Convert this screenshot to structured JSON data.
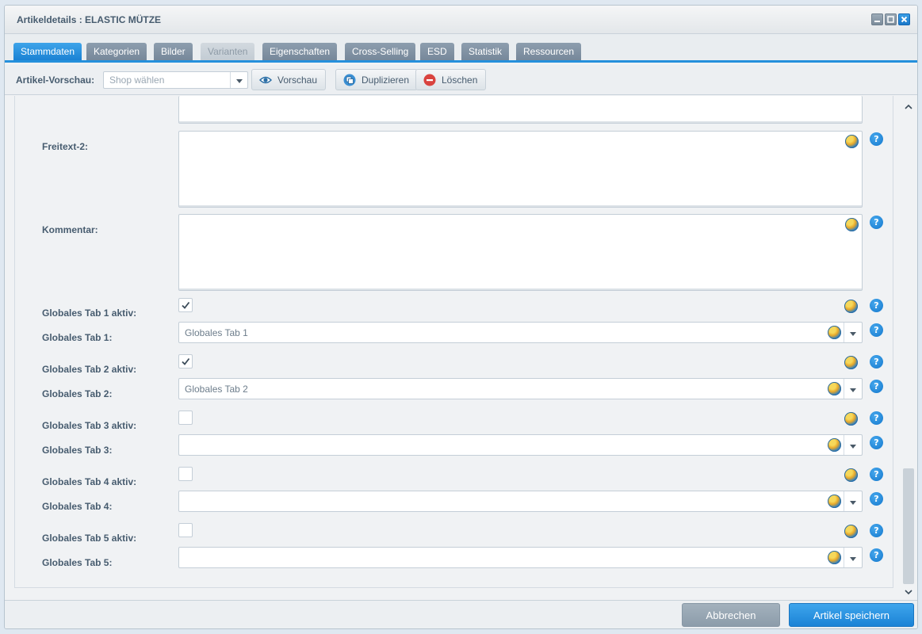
{
  "window": {
    "title": "Artikeldetails : ELASTIC MÜTZE"
  },
  "tabs": [
    {
      "label": "Stammdaten",
      "state": "active"
    },
    {
      "label": "Kategorien",
      "state": "normal"
    },
    {
      "label": "Bilder",
      "state": "normal"
    },
    {
      "label": "Varianten",
      "state": "disabled"
    },
    {
      "label": "Eigenschaften",
      "state": "normal"
    },
    {
      "label": "Cross-Selling",
      "state": "normal"
    },
    {
      "label": "ESD",
      "state": "normal"
    },
    {
      "label": "Statistik",
      "state": "normal"
    },
    {
      "label": "Ressourcen",
      "state": "normal"
    }
  ],
  "toolbar": {
    "preview_label": "Artikel-Vorschau:",
    "shop_placeholder": "Shop wählen",
    "vorschau_label": "Vorschau",
    "duplizieren_label": "Duplizieren",
    "loeschen_label": "Löschen"
  },
  "form": {
    "freitext2_label": "Freitext-2:",
    "kommentar_label": "Kommentar:",
    "tabs": [
      {
        "active_label": "Globales Tab 1 aktiv:",
        "active": true,
        "select_label": "Globales Tab 1:",
        "value": "Globales Tab 1"
      },
      {
        "active_label": "Globales Tab 2 aktiv:",
        "active": true,
        "select_label": "Globales Tab 2:",
        "value": "Globales Tab 2"
      },
      {
        "active_label": "Globales Tab 3 aktiv:",
        "active": false,
        "select_label": "Globales Tab 3:",
        "value": ""
      },
      {
        "active_label": "Globales Tab 4 aktiv:",
        "active": false,
        "select_label": "Globales Tab 4:",
        "value": ""
      },
      {
        "active_label": "Globales Tab 5 aktiv:",
        "active": false,
        "select_label": "Globales Tab 5:",
        "value": ""
      }
    ],
    "help_glyph": "?"
  },
  "footer": {
    "cancel_label": "Abbrechen",
    "save_label": "Artikel speichern"
  },
  "colors": {
    "accent": "#2590dc",
    "tab_inactive": "#8395a6",
    "danger": "#d9433f"
  }
}
